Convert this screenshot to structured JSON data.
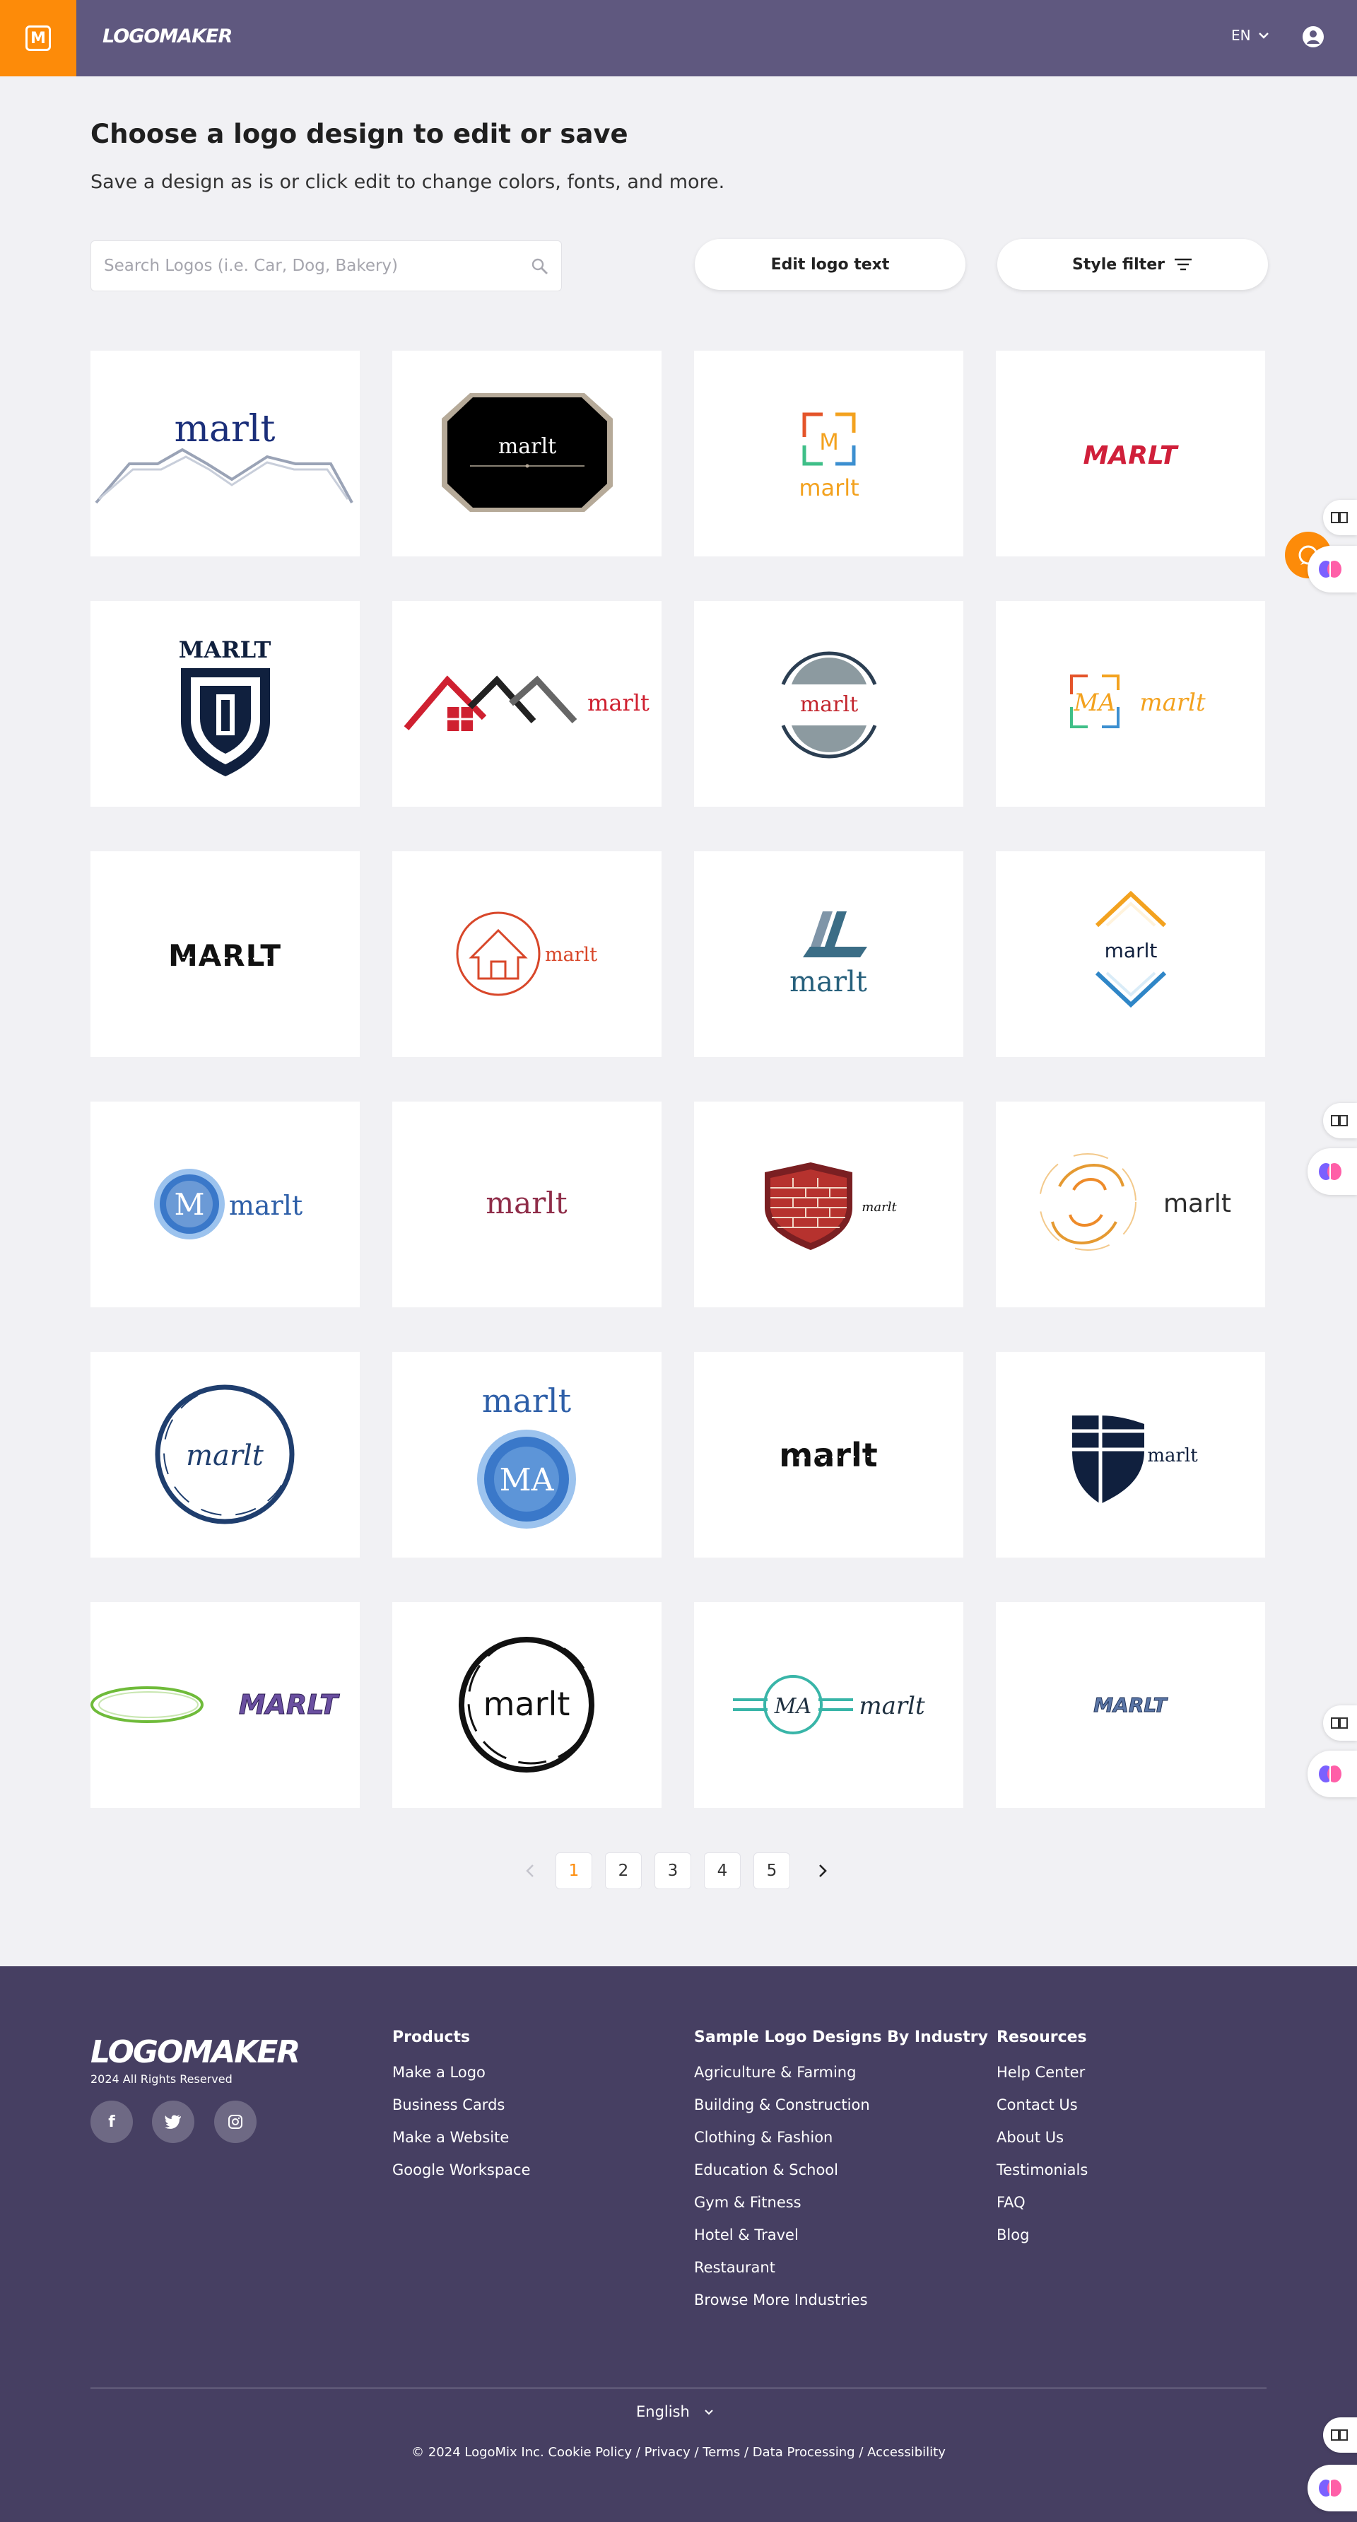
{
  "header": {
    "brand_letter": "M",
    "wordmark": "LOGOMAKER",
    "language": "EN"
  },
  "page": {
    "title": "Choose a logo design to edit or save",
    "subtitle": "Save a design as is or click edit to change colors, fonts, and more."
  },
  "search": {
    "placeholder": "Search Logos (i.e. Car, Dog, Bakery)",
    "value": ""
  },
  "buttons": {
    "edit_logo_text": "Edit logo text",
    "style_filter": "Style filter"
  },
  "logos": {
    "items": [
      {
        "text": "marlt"
      },
      {
        "text": "marlt"
      },
      {
        "text": "marlt",
        "mark": "M"
      },
      {
        "text": "MARLT"
      },
      {
        "text": "MARLT"
      },
      {
        "text": "marlt"
      },
      {
        "text": "marlt"
      },
      {
        "text": "marlt",
        "mark": "MA"
      },
      {
        "text": "MARLT"
      },
      {
        "text": "marlt"
      },
      {
        "text": "marlt"
      },
      {
        "text": "marlt"
      },
      {
        "text": "marlt",
        "mark": "M"
      },
      {
        "text": "marlt"
      },
      {
        "text": "marlt"
      },
      {
        "text": "marlt"
      },
      {
        "text": "marlt"
      },
      {
        "text": "marlt",
        "mark": "MA"
      },
      {
        "text": "marlt"
      },
      {
        "text": "marlt"
      },
      {
        "text": "MARLT"
      },
      {
        "text": "marlt"
      },
      {
        "text": "marlt",
        "mark": "MA"
      },
      {
        "text": "MARLT"
      }
    ]
  },
  "pagination": {
    "prev": "‹",
    "next": "›",
    "pages": [
      "1",
      "2",
      "3",
      "4",
      "5"
    ],
    "current": "1"
  },
  "footer": {
    "wordmark": "LOGOMAKER",
    "copyright_small": "2024 All Rights Reserved",
    "social": [
      "f",
      "t",
      "ig"
    ],
    "products": {
      "heading": "Products",
      "links": [
        "Make a Logo",
        "Business Cards",
        "Make a Website",
        "Google Workspace"
      ]
    },
    "industries": {
      "heading": "Sample Logo Designs By Industry",
      "links": [
        "Agriculture & Farming",
        "Building & Construction",
        "Clothing & Fashion",
        "Education & School",
        "Gym & Fitness",
        "Hotel & Travel",
        "Restaurant",
        "Browse More Industries"
      ]
    },
    "resources": {
      "heading": "Resources",
      "links": [
        "Help Center",
        "Contact Us",
        "About Us",
        "Testimonials",
        "FAQ",
        "Blog"
      ]
    },
    "language": "English",
    "legal": "© 2024 LogoMix Inc. Cookie Policy / Privacy / Terms / Data Processing / Accessibility"
  },
  "colors": {
    "header_bg": "#5f587f",
    "brand_orange": "#fd8b09",
    "footer_bg": "#463f62",
    "page_bg": "#f1f1f4"
  }
}
